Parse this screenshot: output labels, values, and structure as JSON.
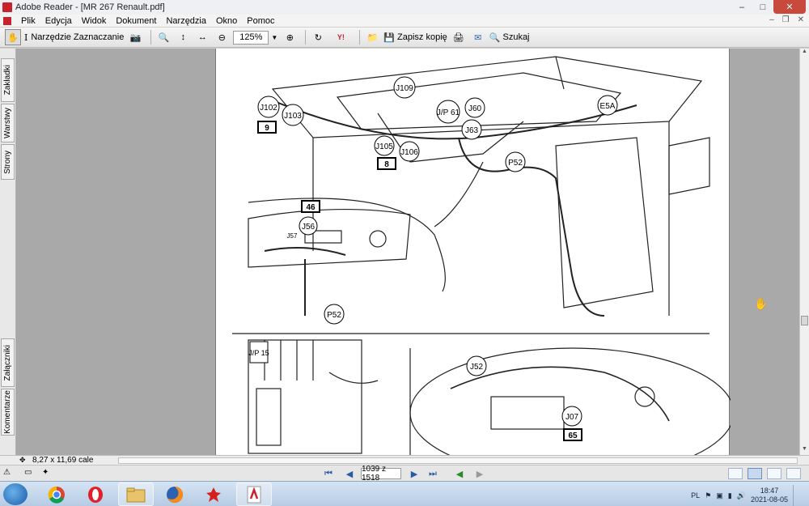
{
  "window": {
    "title": "Adobe Reader - [MR 267 Renault.pdf]"
  },
  "menu": [
    "Plik",
    "Edycja",
    "Widok",
    "Dokument",
    "Narzędzia",
    "Okno",
    "Pomoc"
  ],
  "toolbar": {
    "select_tool_label": "Narzędzie Zaznaczanie",
    "zoom_value": "125%",
    "save_copy_label": "Zapisz kopię",
    "search_label": "Szukaj"
  },
  "side_tabs": [
    "Zakładki",
    "Warstwy",
    "Strony",
    "Załączniki",
    "Komentarze"
  ],
  "status": {
    "page_size": "8,27 x 11,69 cale"
  },
  "navigation": {
    "page_indicator": "1039 z 1518"
  },
  "drawing_labels": {
    "top": [
      "J102",
      "J103",
      "J109",
      "J/P 61",
      "J60",
      "J63",
      "E5A",
      "J105",
      "J106",
      "P52",
      "9",
      "8"
    ],
    "middle": [
      "46",
      "J56",
      "J57",
      "P52"
    ],
    "bottom_left": [
      "J/P 15"
    ],
    "bottom_right": [
      "J52",
      "J07",
      "65"
    ]
  },
  "taskbar": {
    "apps": [
      "start",
      "chrome",
      "opera",
      "explorer",
      "firefox",
      "app-red",
      "adobe-reader"
    ],
    "language": "PL",
    "time": "18:47",
    "date": "2021-08-05"
  },
  "colors": {
    "accent_red": "#c8232c",
    "taskbar": "#c6d6ea"
  }
}
